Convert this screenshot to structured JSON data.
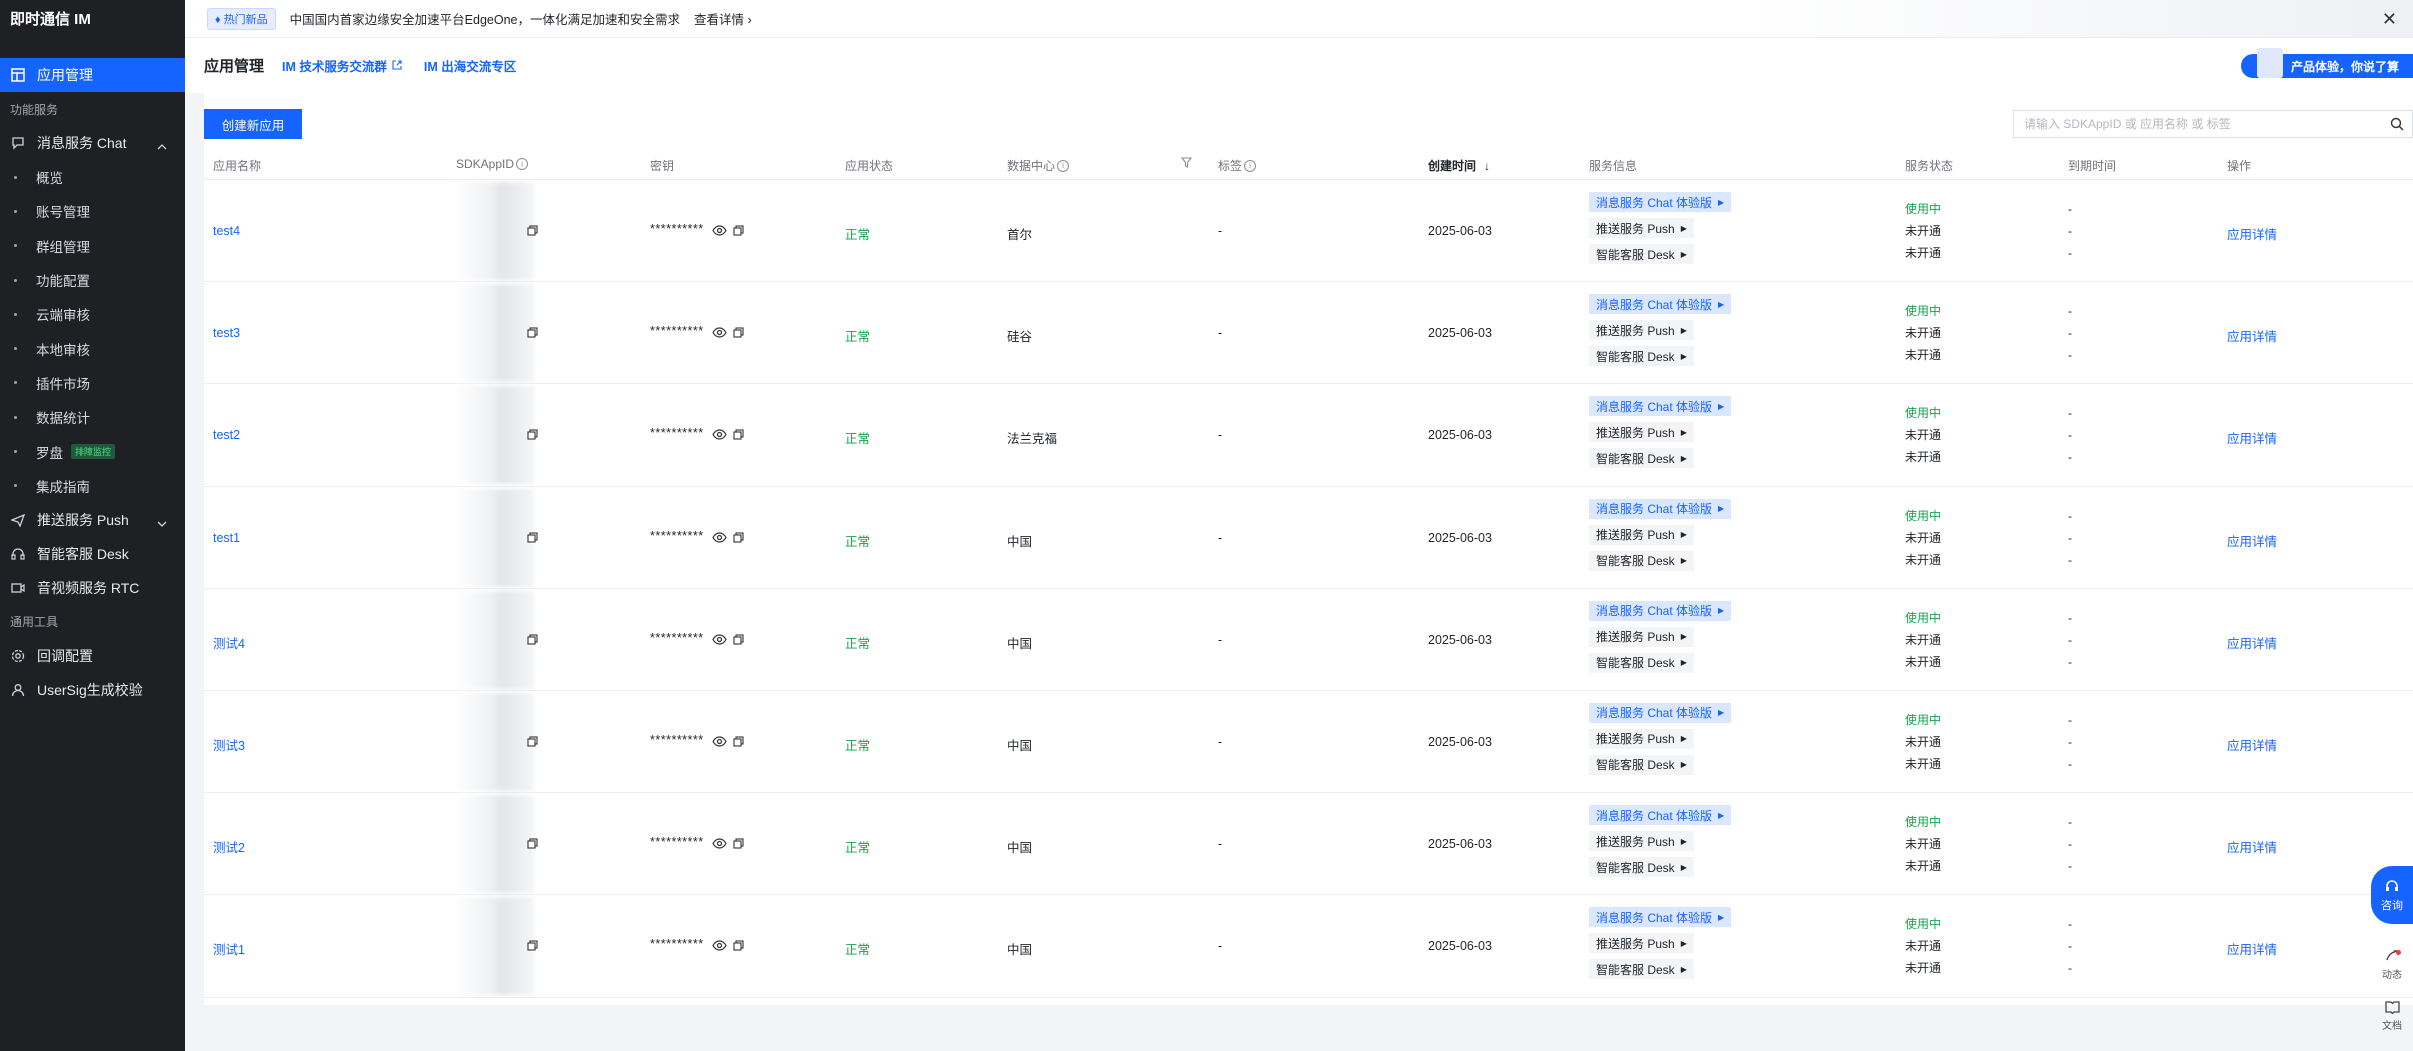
{
  "sidebar": {
    "brand": "即时通信 IM",
    "active_item": "应用管理",
    "section_services": "功能服务",
    "chat_group": "消息服务 Chat",
    "chat_items": [
      "概览",
      "账号管理",
      "群组管理",
      "功能配置",
      "云端审核",
      "本地审核",
      "插件市场",
      "数据统计",
      "罗盘",
      "集成指南"
    ],
    "luopan_tag": "排障监控",
    "push_group": "推送服务 Push",
    "desk_item": "智能客服 Desk",
    "rtc_item": "音视频服务 RTC",
    "section_tools": "通用工具",
    "tool_items": [
      "回调配置",
      "UserSig生成校验"
    ]
  },
  "banner": {
    "tag": "热门新品",
    "text": "中国国内首家边缘安全加速平台EdgeOne，一体化满足加速和安全需求",
    "link": "查看详情"
  },
  "header": {
    "title": "应用管理",
    "link1": "IM 技术服务交流群",
    "link2": "IM 出海交流专区",
    "promo": "产品体验，你说了算"
  },
  "toolbar": {
    "create_label": "创建新应用",
    "search_placeholder": "请输入 SDKAppID 或 应用名称 或 标签"
  },
  "table": {
    "headers": {
      "name": "应用名称",
      "sdkappid": "SDKAppID",
      "key": "密钥",
      "status": "应用状态",
      "datacenter": "数据中心",
      "tag": "标签",
      "created": "创建时间",
      "service_info": "服务信息",
      "service_status": "服务状态",
      "expire": "到期时间",
      "op": "操作"
    },
    "rows": [
      {
        "name": "test4",
        "key": "**********",
        "status": "正常",
        "datacenter": "首尔",
        "tag": "-",
        "created": "2025-06-03",
        "op": "应用详情"
      },
      {
        "name": "test3",
        "key": "**********",
        "status": "正常",
        "datacenter": "硅谷",
        "tag": "-",
        "created": "2025-06-03",
        "op": "应用详情"
      },
      {
        "name": "test2",
        "key": "**********",
        "status": "正常",
        "datacenter": "法兰克福",
        "tag": "-",
        "created": "2025-06-03",
        "op": "应用详情"
      },
      {
        "name": "test1",
        "key": "**********",
        "status": "正常",
        "datacenter": "中国",
        "tag": "-",
        "created": "2025-06-03",
        "op": "应用详情"
      },
      {
        "name": "测试4",
        "key": "**********",
        "status": "正常",
        "datacenter": "中国",
        "tag": "-",
        "created": "2025-06-03",
        "op": "应用详情"
      },
      {
        "name": "测试3",
        "key": "**********",
        "status": "正常",
        "datacenter": "中国",
        "tag": "-",
        "created": "2025-06-03",
        "op": "应用详情"
      },
      {
        "name": "测试2",
        "key": "**********",
        "status": "正常",
        "datacenter": "中国",
        "tag": "-",
        "created": "2025-06-03",
        "op": "应用详情"
      },
      {
        "name": "测试1",
        "key": "**********",
        "status": "正常",
        "datacenter": "中国",
        "tag": "-",
        "created": "2025-06-03",
        "op": "应用详情"
      }
    ],
    "service_info": [
      "消息服务 Chat 体验版",
      "推送服务 Push",
      "智能客服 Desk"
    ],
    "service_status": [
      "使用中",
      "未开通",
      "未开通"
    ],
    "expire": [
      "-",
      "-",
      "-"
    ]
  },
  "float": {
    "consult": "咨询",
    "dynamic": "动态",
    "docs": "文档"
  },
  "colors": {
    "accent": "#1664ff",
    "sidebar_bg": "#1f2024",
    "ok_green": "#16a34a"
  }
}
